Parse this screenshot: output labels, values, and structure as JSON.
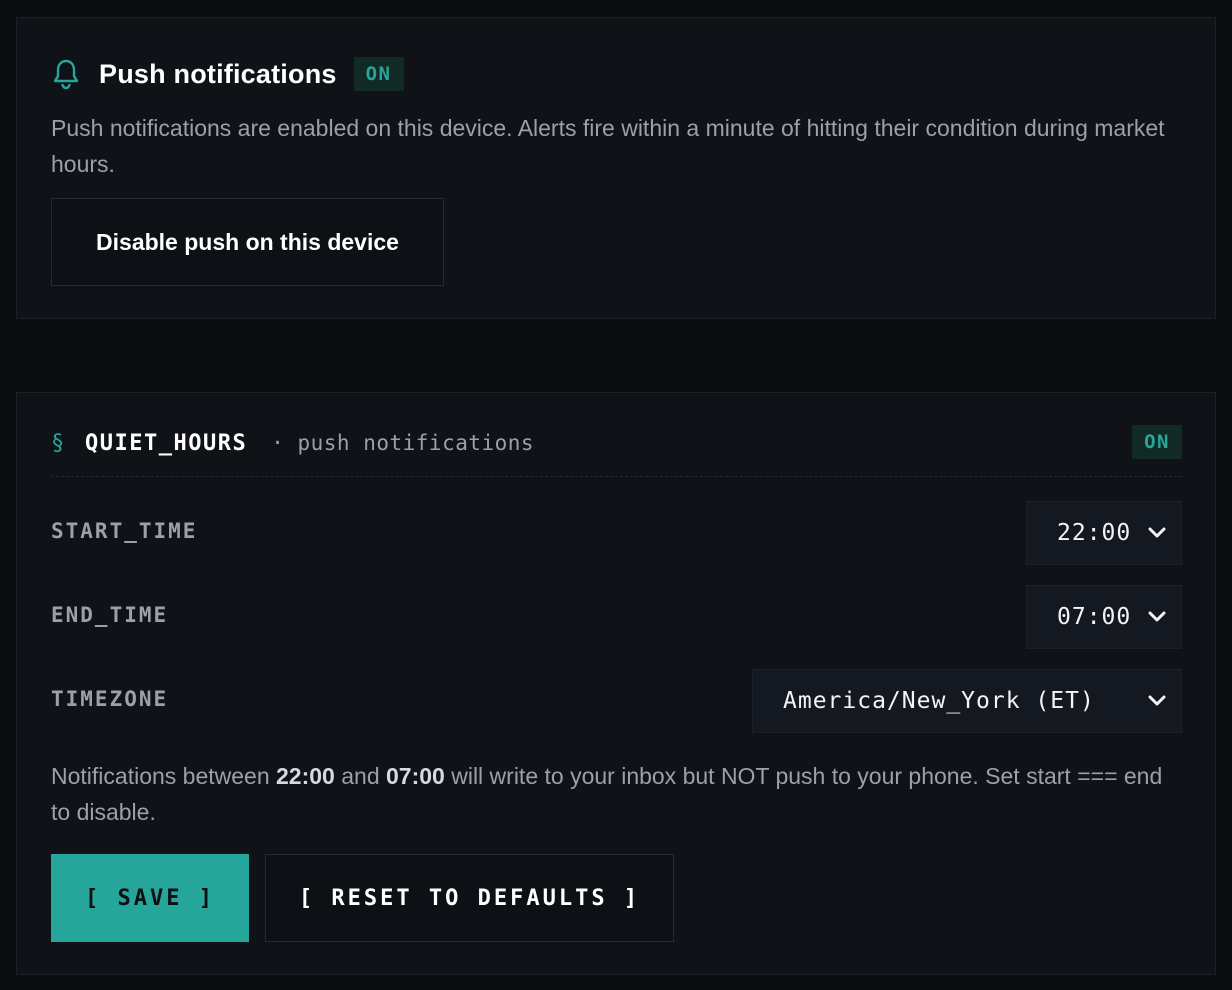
{
  "push": {
    "title": "Push notifications",
    "status_badge": "ON",
    "description": "Push notifications are enabled on this device. Alerts fire within a minute of hitting their condition during market hours.",
    "disable_button": "Disable push on this device",
    "icon": "bell-icon"
  },
  "quiet_hours": {
    "section_symbol": "§",
    "title": "QUIET_HOURS",
    "subtitle": "· push notifications",
    "status_badge": "ON",
    "fields": {
      "start_time": {
        "label": "START_TIME",
        "value": "22:00"
      },
      "end_time": {
        "label": "END_TIME",
        "value": "07:00"
      },
      "timezone": {
        "label": "TIMEZONE",
        "value": "America/New_York (ET)"
      }
    },
    "note": {
      "prefix": "Notifications between ",
      "start": "22:00",
      "middle": " and ",
      "end": "07:00",
      "suffix": " will write to your inbox but NOT push to your phone. Set start === end to disable."
    },
    "save_button": "[ SAVE ]",
    "reset_button": "[ RESET TO DEFAULTS ]"
  },
  "colors": {
    "accent": "#26a69a",
    "background": "#0a0c0f",
    "card": "#0f1217",
    "badge_bg": "#112a24"
  }
}
